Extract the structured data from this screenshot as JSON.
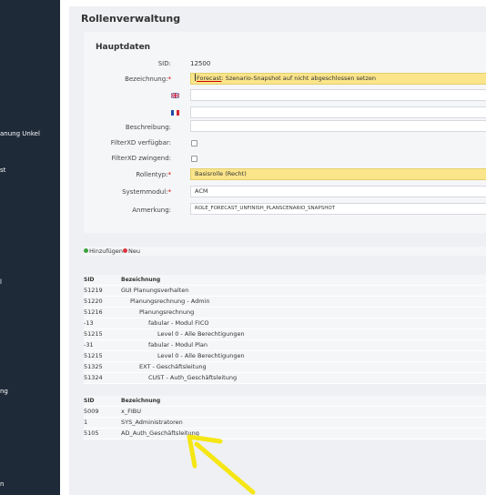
{
  "sidebar": {
    "items": [
      {
        "label": "anung Unkel"
      },
      {
        "label": "st"
      },
      {
        "label": "l"
      },
      {
        "label": "ng"
      },
      {
        "label": "n"
      }
    ]
  },
  "page": {
    "title": "Rollenverwaltung"
  },
  "form": {
    "section_title": "Hauptdaten",
    "sid_label": "SID:",
    "sid_value": "12500",
    "bezeichnung_label": "Bezeichnung:",
    "bezeichnung_value_link": "Forecast",
    "bezeichnung_value_rest": ": Szenario-Snapshot auf nicht abgeschlossen setzen",
    "en_value": "",
    "fr_value": "",
    "beschreibung_label": "Beschreibung:",
    "beschreibung_value": "",
    "filterxd_verfuegbar_label": "FilterXD verfügbar:",
    "filterxd_zwingend_label": "FilterXD zwingend:",
    "rollentyp_label": "Rollentyp:",
    "rollentyp_value": "Basisrolle (Recht)",
    "systemmodul_label": "Systemmodul:",
    "systemmodul_value": "ACM",
    "anmerkung_label": "Anmerkung:",
    "anmerkung_value": "ROLE_FORECAST_UNFINISH_PLANSCENARIO_SNAPSHOT",
    "required_mark": "*"
  },
  "actions": {
    "add_label": "Hinzufügen",
    "new_label": "Neu",
    "add_color": "#3aa03a",
    "new_color": "#d9363e"
  },
  "table1": {
    "headers": [
      "SID",
      "Bezeichnung"
    ],
    "rows": [
      {
        "sid": "51219",
        "bez": "GUI Planungsverhalten",
        "level": 0
      },
      {
        "sid": "51220",
        "bez": "Planungsrechnung - Admin",
        "level": 1
      },
      {
        "sid": "51216",
        "bez": "Planungsrechnung",
        "level": 2
      },
      {
        "sid": "-13",
        "bez": "fabular - Modul FICO",
        "level": 3
      },
      {
        "sid": "51215",
        "bez": "Level 0 - Alle Berechtigungen",
        "level": 4
      },
      {
        "sid": "-31",
        "bez": "fabular - Modul Plan",
        "level": 3
      },
      {
        "sid": "51215",
        "bez": "Level 0 - Alle Berechtigungen",
        "level": 4
      },
      {
        "sid": "51325",
        "bez": "EXT - Geschäftsleitung",
        "level": 2
      },
      {
        "sid": "51324",
        "bez": "CUST - Auth_Geschäftsleitung",
        "level": 3
      }
    ]
  },
  "table2": {
    "headers": [
      "SID",
      "Bezeichnung"
    ],
    "rows": [
      {
        "sid": "5009",
        "bez": "x_FIBU"
      },
      {
        "sid": "1",
        "bez": "SYS_Administratoren"
      },
      {
        "sid": "5105",
        "bez": "AD_Auth_Geschäftsleitung"
      }
    ]
  },
  "colors": {
    "sidebar": "#1e2a38",
    "highlight_field": "#fbe58a",
    "annotation_arrow": "#f5e614"
  }
}
